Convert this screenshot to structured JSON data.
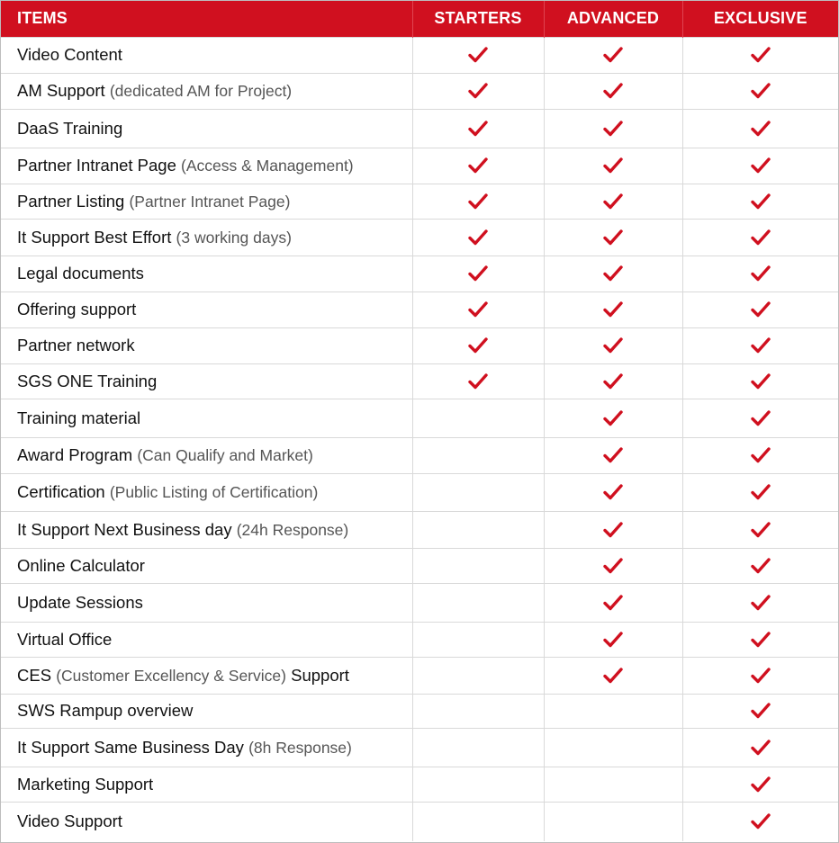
{
  "header": {
    "items": "ITEMS",
    "starters": "STARTERS",
    "advanced": "ADVANCED",
    "exclusive": "EXCLUSIVE"
  },
  "colors": {
    "header_bg": "#d0101f",
    "header_text": "#ffffff",
    "check": "#d0101f",
    "border": "#d9d9d9"
  },
  "icons": {
    "included": "checkmark-icon"
  },
  "rows": [
    {
      "main": "Video Content",
      "paren": "",
      "starters": true,
      "advanced": true,
      "exclusive": true
    },
    {
      "main": "AM Support",
      "paren": "(dedicated AM for Project)",
      "starters": true,
      "advanced": true,
      "exclusive": true
    },
    {
      "main": "DaaS Training",
      "paren": "",
      "starters": true,
      "advanced": true,
      "exclusive": true
    },
    {
      "main": "Partner Intranet Page",
      "paren": "(Access & Management)",
      "starters": true,
      "advanced": true,
      "exclusive": true
    },
    {
      "main": "Partner Listing",
      "paren": "(Partner Intranet Page)",
      "starters": true,
      "advanced": true,
      "exclusive": true
    },
    {
      "main": "It Support Best Effort",
      "paren": "(3 working days)",
      "starters": true,
      "advanced": true,
      "exclusive": true
    },
    {
      "main": "Legal documents",
      "paren": "",
      "starters": true,
      "advanced": true,
      "exclusive": true
    },
    {
      "main": "Offering support",
      "paren": "",
      "starters": true,
      "advanced": true,
      "exclusive": true
    },
    {
      "main": "Partner network",
      "paren": "",
      "starters": true,
      "advanced": true,
      "exclusive": true
    },
    {
      "main": "SGS ONE Training",
      "paren": "",
      "starters": true,
      "advanced": true,
      "exclusive": true
    },
    {
      "main": "Training material",
      "paren": "",
      "starters": false,
      "advanced": true,
      "exclusive": true
    },
    {
      "main": "Award Program",
      "paren": "(Can Qualify and Market)",
      "starters": false,
      "advanced": true,
      "exclusive": true
    },
    {
      "main": "Certification",
      "paren": "(Public Listing of Certification)",
      "starters": false,
      "advanced": true,
      "exclusive": true
    },
    {
      "main": "It Support Next Business day",
      "paren": "(24h Response)",
      "starters": false,
      "advanced": true,
      "exclusive": true
    },
    {
      "main": "Online Calculator",
      "paren": "",
      "starters": false,
      "advanced": true,
      "exclusive": true
    },
    {
      "main": "Update Sessions",
      "paren": "",
      "starters": false,
      "advanced": true,
      "exclusive": true
    },
    {
      "main": "Virtual Office",
      "paren": "",
      "starters": false,
      "advanced": true,
      "exclusive": true
    },
    {
      "main": "CES",
      "paren": "(Customer Excellency & Service)",
      "suffix": "Support",
      "starters": false,
      "advanced": true,
      "exclusive": true
    },
    {
      "main": "SWS Rampup overview",
      "paren": "",
      "starters": false,
      "advanced": false,
      "exclusive": true
    },
    {
      "main": "It Support Same Business Day",
      "paren": "(8h Response)",
      "starters": false,
      "advanced": false,
      "exclusive": true
    },
    {
      "main": "Marketing Support",
      "paren": "",
      "starters": false,
      "advanced": false,
      "exclusive": true
    },
    {
      "main": "Video Support",
      "paren": "",
      "starters": false,
      "advanced": false,
      "exclusive": true
    }
  ]
}
